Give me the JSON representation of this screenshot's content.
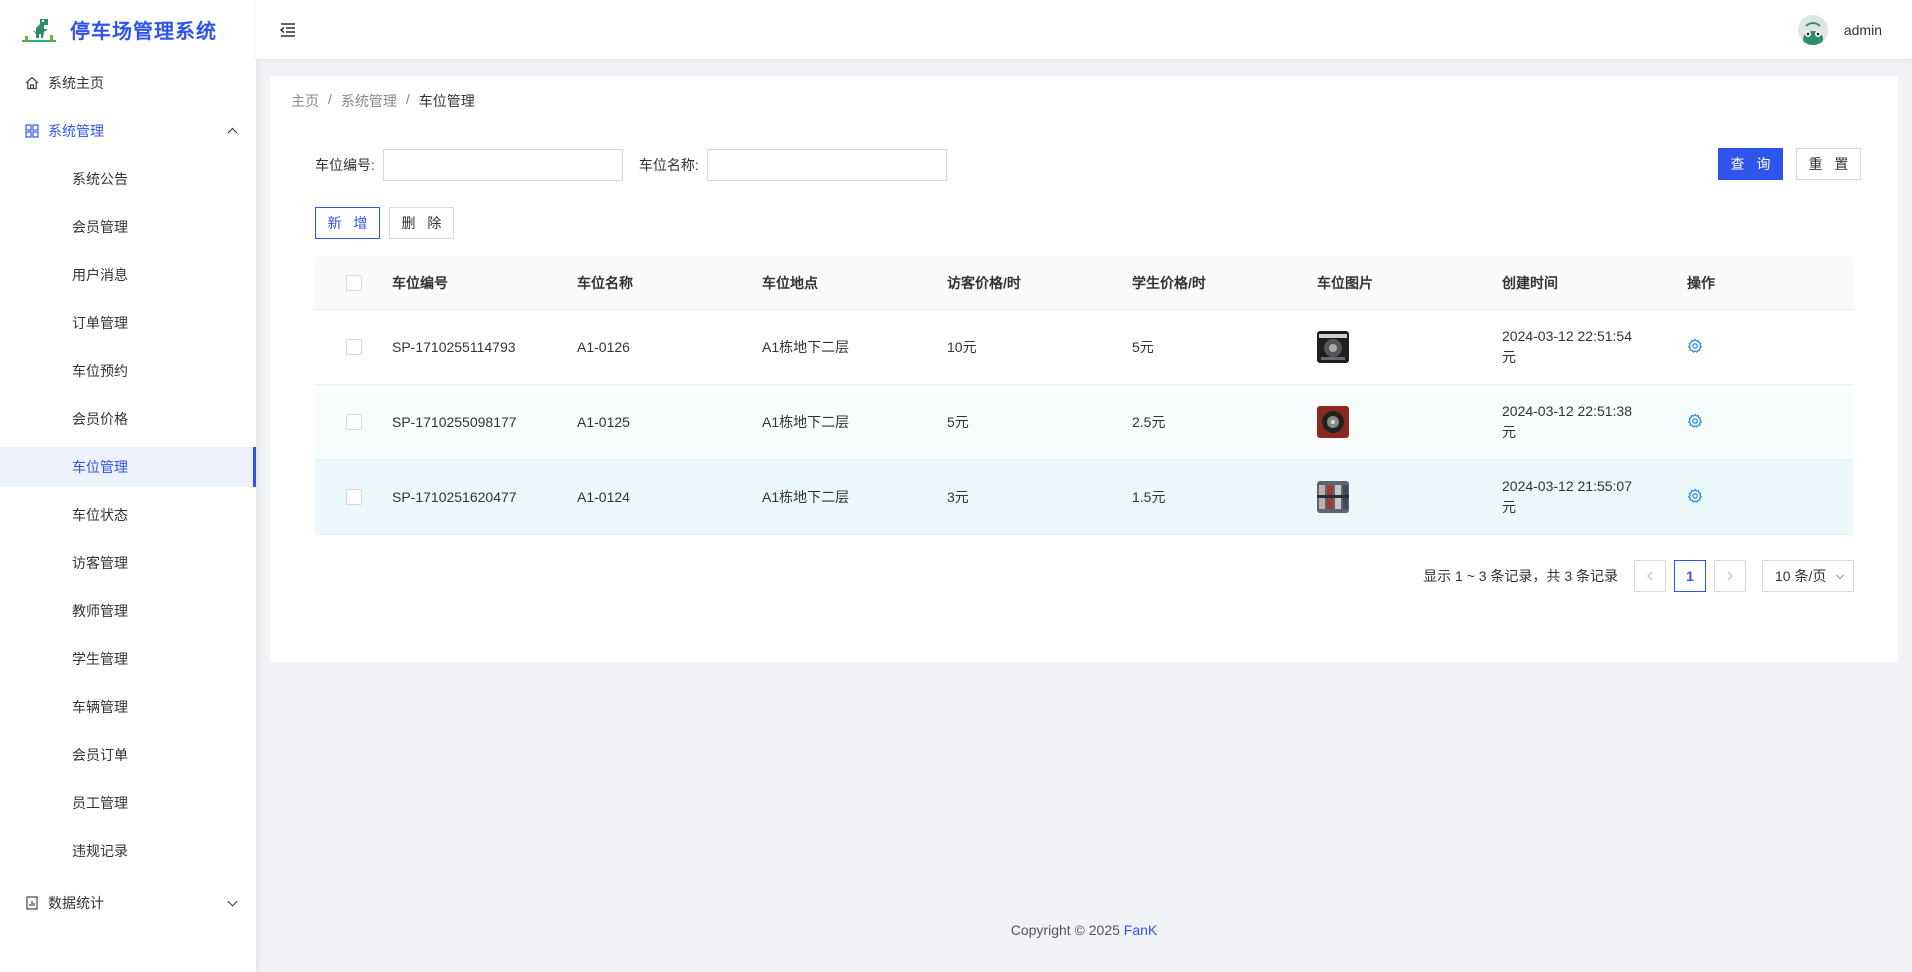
{
  "app": {
    "title": "停车场管理系统"
  },
  "sidebar": {
    "home": {
      "label": "系统主页",
      "icon": "home-icon"
    },
    "system": {
      "label": "系统管理",
      "icon": "grid-icon",
      "expanded": true
    },
    "sub_items": [
      {
        "label": "系统公告"
      },
      {
        "label": "会员管理"
      },
      {
        "label": "用户消息"
      },
      {
        "label": "订单管理"
      },
      {
        "label": "车位预约"
      },
      {
        "label": "会员价格"
      },
      {
        "label": "车位管理",
        "active": true
      },
      {
        "label": "车位状态"
      },
      {
        "label": "访客管理"
      },
      {
        "label": "教师管理"
      },
      {
        "label": "学生管理"
      },
      {
        "label": "车辆管理"
      },
      {
        "label": "会员订单"
      },
      {
        "label": "员工管理"
      },
      {
        "label": "违规记录"
      }
    ],
    "stats": {
      "label": "数据统计",
      "icon": "chart-doc-icon",
      "expanded": false
    }
  },
  "header": {
    "username": "admin"
  },
  "breadcrumb": {
    "home": "主页",
    "section": "系统管理",
    "current": "车位管理",
    "separator": "/"
  },
  "filters": {
    "code_label": "车位编号:",
    "code_value": "",
    "name_label": "车位名称:",
    "name_value": ""
  },
  "buttons": {
    "query": "查 询",
    "reset": "重 置",
    "add": "新 增",
    "delete": "删 除"
  },
  "table": {
    "headers": [
      "车位编号",
      "车位名称",
      "车位地点",
      "访客价格/时",
      "学生价格/时",
      "车位图片",
      "创建时间",
      "操作"
    ],
    "rows": [
      {
        "code": "SP-1710255114793",
        "name": "A1-0126",
        "location": "A1栋地下二层",
        "visitor_price": "10元",
        "student_price": "5元",
        "created": "2024-03-12 22:51:54",
        "suffix": "元"
      },
      {
        "code": "SP-1710255098177",
        "name": "A1-0125",
        "location": "A1栋地下二层",
        "visitor_price": "5元",
        "student_price": "2.5元",
        "created": "2024-03-12 22:51:38",
        "suffix": "元"
      },
      {
        "code": "SP-1710251620477",
        "name": "A1-0124",
        "location": "A1栋地下二层",
        "visitor_price": "3元",
        "student_price": "1.5元",
        "created": "2024-03-12 21:55:07",
        "suffix": "元"
      }
    ]
  },
  "pagination": {
    "summary": "显示 1 ~ 3 条记录，共 3 条记录",
    "current_page": "1",
    "page_size": "10 条/页"
  },
  "footer": {
    "copyright": "Copyright © 2025",
    "author": "FanK"
  },
  "colors": {
    "primary": "#2f54eb",
    "bg": "#f0f2f5"
  }
}
